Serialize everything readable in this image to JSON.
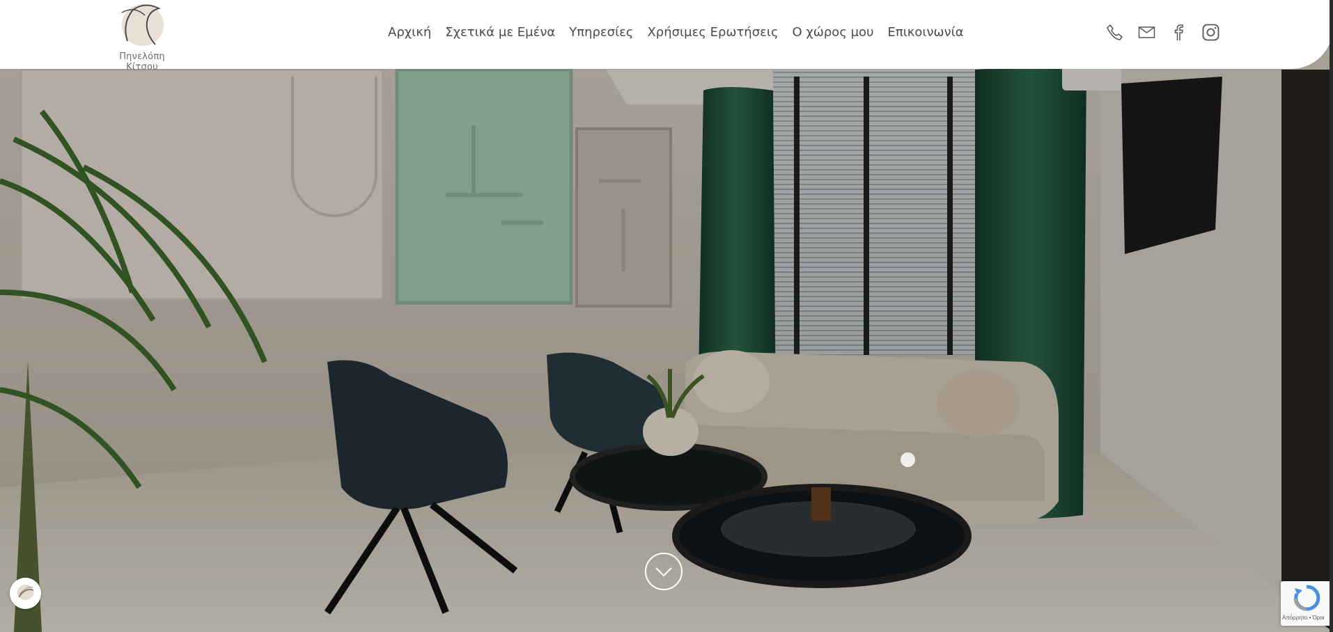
{
  "site": {
    "brand_name": "Πηνελόπη Κίτσου"
  },
  "nav": {
    "items": [
      {
        "label": "Αρχική"
      },
      {
        "label": "Σχετικά με Εμένα"
      },
      {
        "label": "Υπηρεσίες"
      },
      {
        "label": "Χρήσιμες Ερωτήσεις"
      },
      {
        "label": "Ο χώρος μου"
      },
      {
        "label": "Επικοινωνία"
      }
    ]
  },
  "header_icons": [
    "phone-icon",
    "email-icon",
    "facebook-icon",
    "instagram-icon"
  ],
  "hero": {
    "slide_count": 1,
    "active_slide": 1
  },
  "recaptcha": {
    "text": "Απόρρητο • Όροι"
  },
  "colors": {
    "nav_text": "#4a4a4a",
    "header_bg": "#ffffff",
    "curtain_green": "#1f4d3a",
    "wall_panel_mint": "#a9cbb5"
  }
}
